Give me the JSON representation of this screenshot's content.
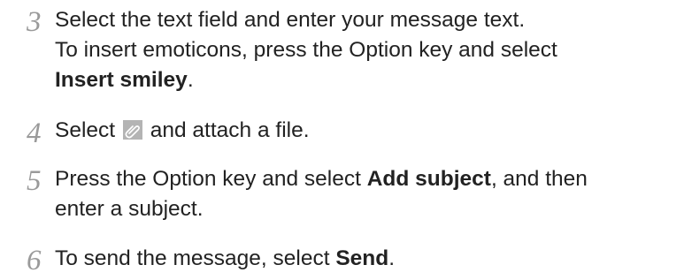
{
  "steps": [
    {
      "number": "3",
      "line1": "Select the text field and enter your message text.",
      "line2": "To insert emoticons, press the Option key and select",
      "bold1": "Insert smiley",
      "after_bold1": "."
    },
    {
      "number": "4",
      "before_icon": "Select",
      "icon": "paperclip-icon",
      "after_icon": "and attach a file."
    },
    {
      "number": "5",
      "before_bold": "Press the Option key and select ",
      "bold": "Add subject",
      "after_bold": ", and then",
      "line2": "enter a subject."
    },
    {
      "number": "6",
      "before_bold": "To send the message, select ",
      "bold": "Send",
      "after_bold": "."
    }
  ]
}
